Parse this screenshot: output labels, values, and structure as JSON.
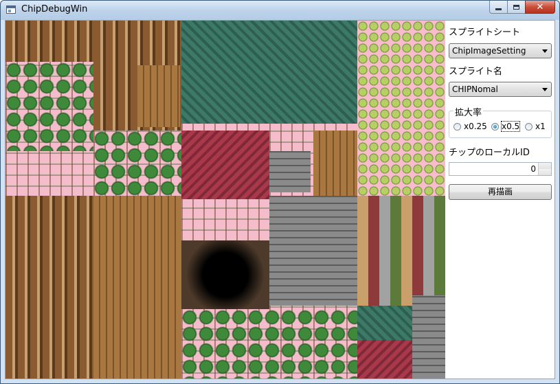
{
  "window": {
    "title": "ChipDebugWin",
    "close_glyph": "✕"
  },
  "panel": {
    "sprite_sheet_label": "スプライトシート",
    "sprite_sheet_value": "ChipImageSetting",
    "sprite_name_label": "スプライト名",
    "sprite_name_value": "CHIPNomal",
    "zoom_label": "拡大率",
    "zoom_options": [
      "x0.25",
      "x0.5",
      "x1"
    ],
    "zoom_selected": "x0.5",
    "local_id_label": "チップのローカルID",
    "local_id_value": "0",
    "redraw_button": "再描画"
  },
  "colors": {
    "canvas_background": "#f5bccb",
    "accent": "#1c6aa8"
  }
}
